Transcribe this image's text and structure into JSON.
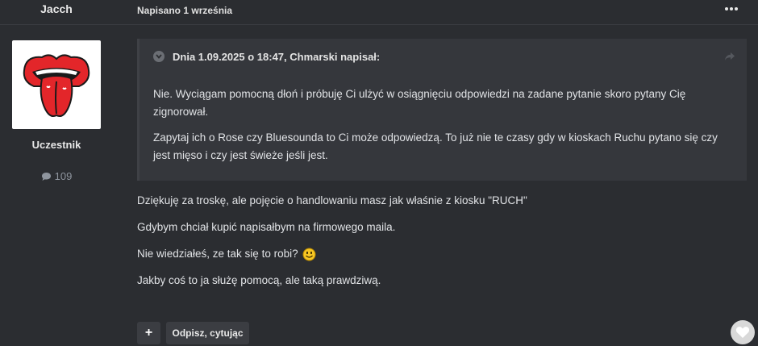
{
  "author": {
    "name": "Jacch",
    "role": "Uczestnik",
    "post_count": "109",
    "avatar_icon": "rolling-stones-tongue-logo"
  },
  "post": {
    "date": "Napisano 1 września",
    "more_icon": "ellipsis-icon"
  },
  "quote": {
    "citation": "Dnia 1.09.2025 o 18:47, Chmarski napisał:",
    "paragraphs": [
      "Nie. Wyciągam pomocną dłoń i próbuję Ci ulżyć w osiągnięciu odpowiedzi na zadane pytanie skoro pytany Cię zignorował.",
      "Zapytaj ich o Rose czy Bluesounda to Ci może odpowiedzą. To już nie te czasy gdy w kioskach Ruchu pytano się czy jest mięso i czy jest świeże jeśli jest."
    ]
  },
  "body": {
    "paragraphs": [
      "Dziękuję za troskę, ale pojęcie o handlowaniu masz jak właśnie z kiosku \"RUCH\"",
      "Gdybym chciał kupić napisałbym na firmowego maila.",
      "Nie wiedziałeś, ze tak się to robi?",
      "Jakby coś to ja służę pomocą, ale taką prawdziwą."
    ]
  },
  "actions": {
    "plus_label": "+",
    "reply_quote_label": "Odpisz, cytując"
  },
  "colors": {
    "background": "#2b2d31",
    "quote_background": "#35373c",
    "button_background": "#3b3d42"
  }
}
